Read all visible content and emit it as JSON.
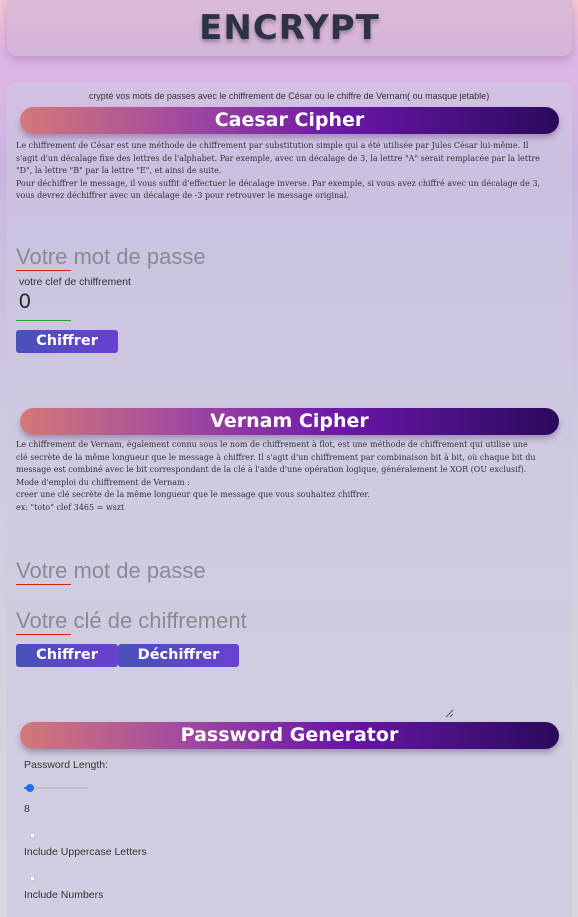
{
  "header": {
    "title": "ENCRYPT"
  },
  "intro": "crypté vos mots de passes avec le chiffrement de César ou le chiffre de Vernam( ou masque jetable)",
  "caesar": {
    "title": "Caesar Cipher",
    "description": [
      "Le chiffrement de César est une méthode de chiffrement par substitution simple qui a été utilisée par Jules César lui-même. Il",
      "s'agit d'un décalage fixe des lettres de l'alphabet. Par exemple, avec un décalage de 3, la lettre \"A\" serait remplacée par la lettre",
      "\"D\", la lettre \"B\" par la lettre \"E\", et ainsi de suite.",
      "Pour déchiffrer le message, il vous suffit d'effectuer le décalage inverse. Par exemple, si vous avez chiffré avec un décalage de 3,",
      "vous devrez déchiffrer avec un décalage de -3 pour retrouver le message original."
    ],
    "password_placeholder": "Votre mot de passe",
    "key_label": "votre clef de chiffrement",
    "key_value": "0",
    "encrypt_button": "Chiffrer"
  },
  "vernam": {
    "title": "Vernam Cipher",
    "description": [
      "Le chiffrement de Vernam, également connu sous le nom de chiffrement à flot, est une méthode de chiffrement qui utilise une",
      "clé secrète de la même longueur que le message à chiffrer. Il s'agit d'un chiffrement par combinaison bit à bit, où chaque bit du",
      "message est combiné avec le bit correspondant de la clé à l'aide d'une opération logique, généralement le XOR (OU exclusif).",
      "Mode d'emploi du chiffrement de Vernam :",
      "creer une clé secrète de la même longueur que le message que vous souhaitez chiffrer.",
      "ex: \"toto\" clef 3465 = wszt"
    ],
    "password_placeholder": "Votre mot de passe",
    "key_placeholder": "Votre clé de chiffrement",
    "encrypt_button": "Chiffrer",
    "decrypt_button": "Déchiffrer"
  },
  "generator": {
    "title": "Password Generator",
    "length_label": "Password Length:",
    "length_value": "8",
    "length_fraction": 0.1,
    "uppercase_label": "Include Uppercase Letters",
    "numbers_label": "Include Numbers"
  },
  "colors": {
    "accent_blue": "#1a73e8",
    "button_gradient_start": "#4752b8",
    "button_gradient_end": "#6a40d0",
    "bar_gradient_start": "#d47878",
    "bar_gradient_end": "#2a0a5c"
  },
  "icons": {
    "resize": "resize-handle-icon"
  }
}
